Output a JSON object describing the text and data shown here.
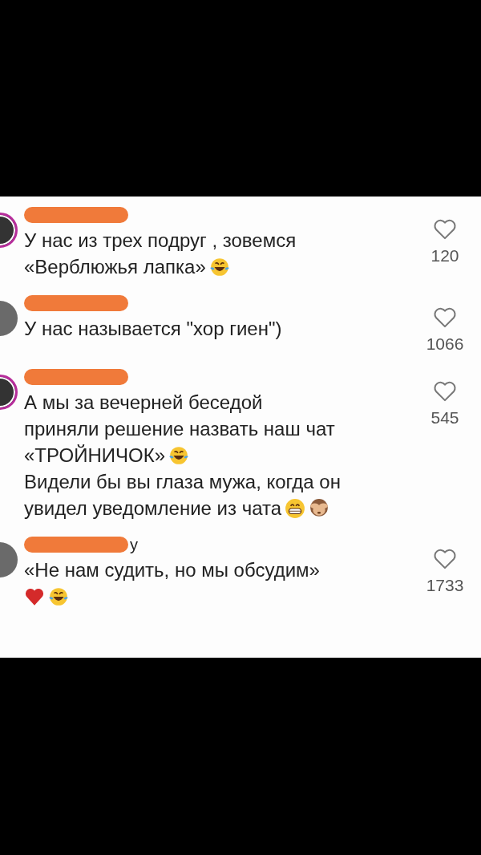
{
  "comments": [
    {
      "avatar_ring": true,
      "lines": [
        {
          "text": "У нас из трех подруг , зовемся"
        },
        {
          "text": "«Верблюжья лапка»",
          "emojis": [
            {
              "kind": "laughing"
            }
          ]
        }
      ],
      "likes": "120"
    },
    {
      "avatar_ring": false,
      "lines": [
        {
          "text": "У нас называется \"хор гиен\")"
        }
      ],
      "likes": "1066"
    },
    {
      "avatar_ring": true,
      "lines": [
        {
          "text": "А мы за вечерней беседой"
        },
        {
          "text": "приняли решение назвать наш чат"
        },
        {
          "text": "«ТРОЙНИЧОК»",
          "emojis": [
            {
              "kind": "laughing"
            }
          ]
        },
        {
          "text": "Видели бы вы глаза мужа, когда он"
        },
        {
          "text": "увидел уведомление из чата",
          "emojis": [
            {
              "kind": "grinning"
            },
            {
              "kind": "monkey"
            }
          ]
        }
      ],
      "likes": "545"
    },
    {
      "avatar_ring": false,
      "username_visible": "у",
      "lines": [
        {
          "text": "«Не нам судить, но мы обсудим»"
        },
        {
          "emojis": [
            {
              "kind": "heart"
            },
            {
              "kind": "laughing"
            }
          ]
        }
      ],
      "likes": "1733"
    }
  ]
}
